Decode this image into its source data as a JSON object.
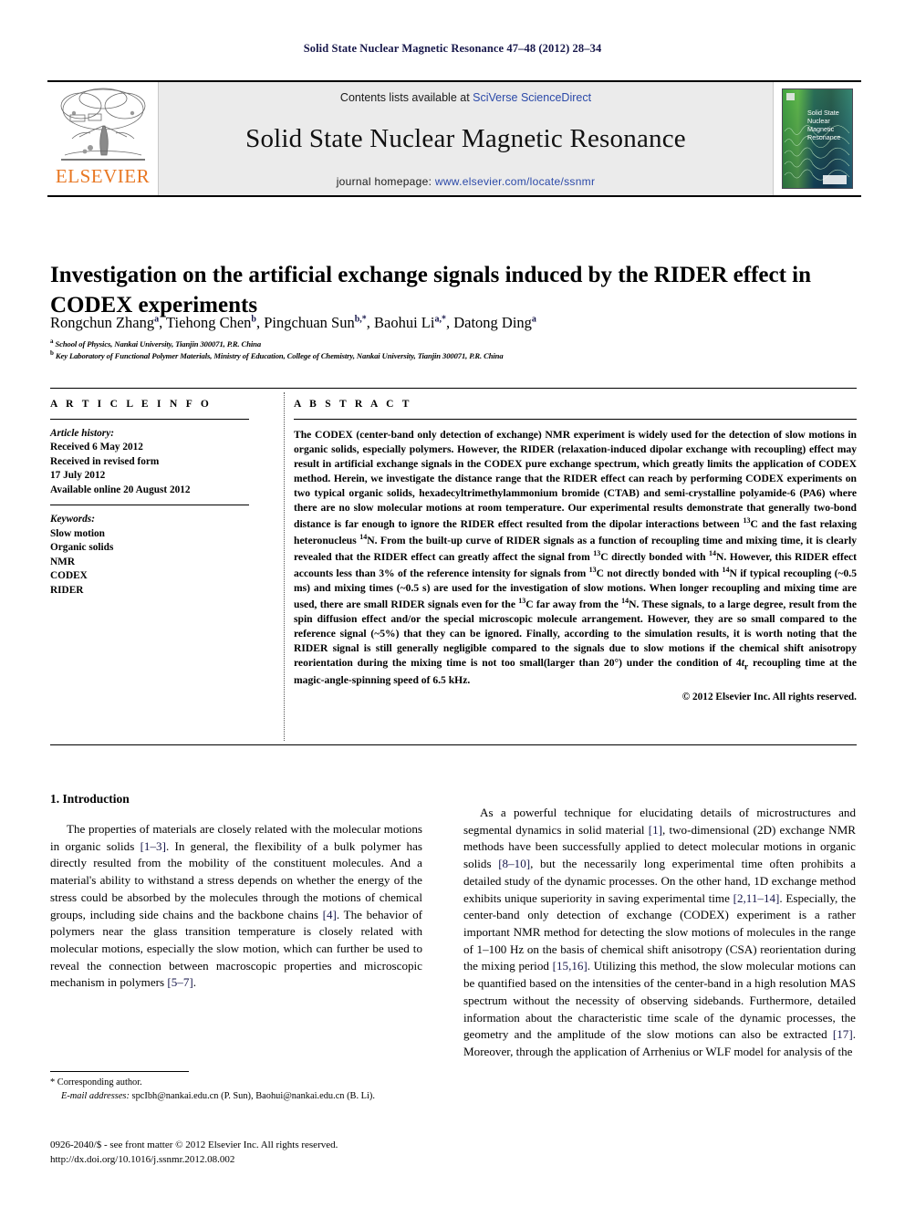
{
  "running_head": "Solid State Nuclear Magnetic Resonance 47–48 (2012) 28–34",
  "masthead": {
    "publisher_name": "ELSEVIER",
    "contents_prefix": "Contents lists available at ",
    "contents_link": "SciVerse ScienceDirect",
    "journal_title": "Solid State Nuclear Magnetic Resonance",
    "homepage_prefix": "journal homepage: ",
    "homepage_url": "www.elsevier.com/locate/ssnmr",
    "cover_title_lines": [
      "Solid State",
      "Nuclear",
      "Magnetic",
      "Resonance"
    ]
  },
  "article": {
    "title": "Investigation on the artificial exchange signals induced by the RIDER effect in CODEX experiments",
    "authors": "Rongchun Zhang a, Tiehong Chen b, Pingchuan Sun b,*, Baohui Li a,*, Datong Ding a",
    "affiliation_a": "a School of Physics, Nankai University, Tianjin 300071, P.R. China",
    "affiliation_b": "b Key Laboratory of Functional Polymer Materials, Ministry of Education, College of Chemistry, Nankai University, Tianjin 300071, P.R. China"
  },
  "article_info": {
    "heading": "A R T I C L E   I N F O",
    "history_label": "Article history:",
    "history_lines": [
      "Received 6 May 2012",
      "Received in revised form",
      "17 July 2012",
      "Available online 20 August 2012"
    ],
    "keywords_label": "Keywords:",
    "keywords": [
      "Slow motion",
      "Organic solids",
      "NMR",
      "CODEX",
      "RIDER"
    ]
  },
  "abstract": {
    "heading": "A B S T R A C T",
    "text": "The CODEX (center-band only detection of exchange) NMR experiment is widely used for the detection of slow motions in organic solids, especially polymers. However, the RIDER (relaxation-induced dipolar exchange with recoupling) effect may result in artificial exchange signals in the CODEX pure exchange spectrum, which greatly limits the application of CODEX method. Herein, we investigate the distance range that the RIDER effect can reach by performing CODEX experiments on two typical organic solids, hexadecyltrimethylammonium bromide (CTAB) and semi-crystalline polyamide-6 (PA6) where there are no slow molecular motions at room temperature. Our experimental results demonstrate that generally two-bond distance is far enough to ignore the RIDER effect resulted from the dipolar interactions between 13C and the fast relaxing heteronucleus 14N. From the built-up curve of RIDER signals as a function of recoupling time and mixing time, it is clearly revealed that the RIDER effect can greatly affect the signal from 13C directly bonded with 14N. However, this RIDER effect accounts less than 3% of the reference intensity for signals from 13C not directly bonded with 14N if typical recoupling (~0.5 ms) and mixing times (~0.5 s) are used for the investigation of slow motions. When longer recoupling and mixing time are used, there are small RIDER signals even for the 13C far away from the 14N. These signals, to a large degree, result from the spin diffusion effect and/or the special microscopic molecule arrangement. However, they are so small compared to the reference signal (~5%) that they can be ignored. Finally, according to the simulation results, it is worth noting that the RIDER signal is still generally negligible compared to the signals due to slow motions if the chemical shift anisotropy reorientation during the mixing time is not too small(larger than 20°) under the condition of 4tr recoupling time at the magic-angle-spinning speed of 6.5 kHz.",
    "copyright": "© 2012 Elsevier Inc. All rights reserved."
  },
  "body": {
    "section_title": "1.  Introduction",
    "left_paragraph_1": "The properties of materials are closely related with the molecular motions in organic solids [1–3]. In general, the flexibility of a bulk polymer has directly resulted from the mobility of the constituent molecules. And a material's ability to withstand a stress depends on whether the energy of the stress could be absorbed by the molecules through the motions of chemical groups, including side chains and the backbone chains [4]. The behavior of polymers near the glass transition temperature is closely related with molecular motions, especially the slow motion, which can further be used to reveal the connection between macroscopic properties and microscopic mechanism in polymers [5–7].",
    "right_paragraph_1": "As a powerful technique for elucidating details of microstructures and segmental dynamics in solid material [1], two-dimensional (2D) exchange NMR methods have been successfully applied to detect molecular motions in organic solids [8–10], but the necessarily long experimental time often prohibits a detailed study of the dynamic processes. On the other hand, 1D exchange method exhibits unique superiority in saving experimental time [2,11–14]. Especially, the center-band only detection of exchange (CODEX) experiment is a rather important NMR method for detecting the slow motions of molecules in the range of 1–100 Hz on the basis of chemical shift anisotropy (CSA) reorientation during the mixing period [15,16]. Utilizing this method, the slow molecular motions can be quantified based on the intensities of the center-band in a high resolution MAS spectrum without the necessity of observing sidebands. Furthermore, detailed information about the characteristic time scale of the dynamic processes, the geometry and the amplitude of the slow motions can also be extracted [17]. Moreover, through the application of Arrhenius or WLF model for analysis of the"
  },
  "footnote": {
    "corresponding": "* Corresponding author.",
    "email_label": "E-mail addresses:",
    "email_text": " spcIbh@nankai.edu.cn (P. Sun), Baohui@nankai.edu.cn (B. Li)."
  },
  "imprint": {
    "line1": "0926-2040/$ - see front matter © 2012 Elsevier Inc. All rights reserved.",
    "line2": "http://dx.doi.org/10.1016/j.ssnmr.2012.08.002"
  },
  "colors": {
    "link": "#2b49a8",
    "elsevier_orange": "#E87722",
    "running_head": "#17174a",
    "reference": "#17174a"
  }
}
